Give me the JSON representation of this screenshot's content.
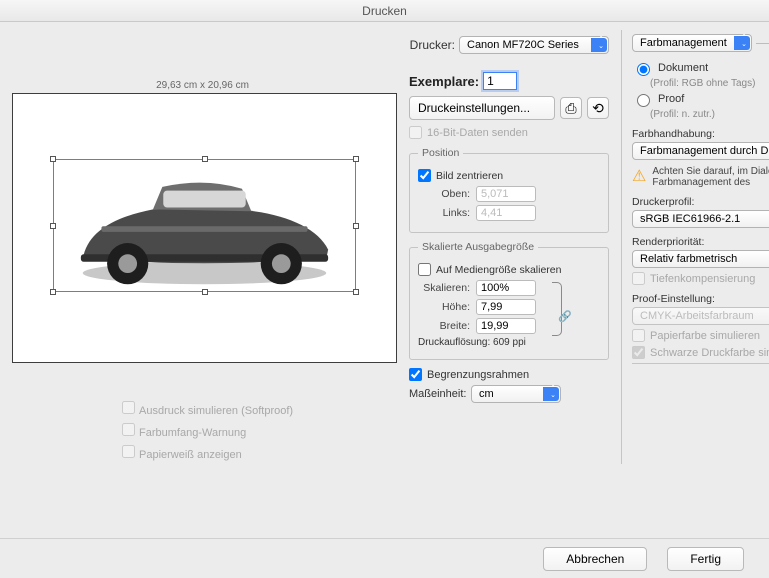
{
  "window": {
    "title": "Drucken"
  },
  "printer": {
    "label": "Drucker:",
    "value": "Canon MF720C Series"
  },
  "preview": {
    "dimensions": "29,63 cm x 20,96 cm"
  },
  "proofOptions": {
    "softproof": "Ausdruck simulieren (Softproof)",
    "gamut": "Farbumfang-Warnung",
    "paperwhite": "Papierweiß anzeigen"
  },
  "copies": {
    "label": "Exemplare:",
    "value": "1"
  },
  "settingsBtn": "Druckeinstellungen...",
  "send16bit": "16-Bit-Daten senden",
  "position": {
    "legend": "Position",
    "center": "Bild zentrieren",
    "topLabel": "Oben:",
    "topValue": "5,071",
    "leftLabel": "Links:",
    "leftValue": "4,41"
  },
  "scale": {
    "legend": "Skalierte Ausgabegröße",
    "fitMedia": "Auf Mediengröße skalieren",
    "scaleLabel": "Skalieren:",
    "scaleValue": "100%",
    "heightLabel": "Höhe:",
    "heightValue": "7,99",
    "widthLabel": "Breite:",
    "widthValue": "19,99",
    "resolution": "Druckauflösung: 609 ppi"
  },
  "bounds": "Begrenzungsrahmen",
  "units": {
    "label": "Maßeinheit:",
    "value": "cm"
  },
  "cm": {
    "dropdown": "Farbmanagement",
    "docRadio": "Dokument",
    "docProfile": "(Profil: RGB ohne Tags)",
    "proofRadio": "Proof",
    "proofProfile": "(Profil: n. zutr.)",
    "handlingLabel": "Farbhandhabung:",
    "handlingValue": "Farbmanagement durch Drucker",
    "warning": "Achten Sie darauf, im Dialog das Farbmanagement des",
    "printerProfileLabel": "Druckerprofil:",
    "printerProfileValue": "sRGB IEC61966-2.1",
    "renderLabel": "Renderpriorität:",
    "renderValue": "Relativ farbmetrisch",
    "depthComp": "Tiefenkompensierung",
    "proofSetupLabel": "Proof-Einstellung:",
    "proofSetupValue": "CMYK-Arbeitsfarbraum",
    "simPaper": "Papierfarbe simulieren",
    "simBlack": "Schwarze Druckfarbe simulieren"
  },
  "footer": {
    "cancel": "Abbrechen",
    "done": "Fertig"
  }
}
